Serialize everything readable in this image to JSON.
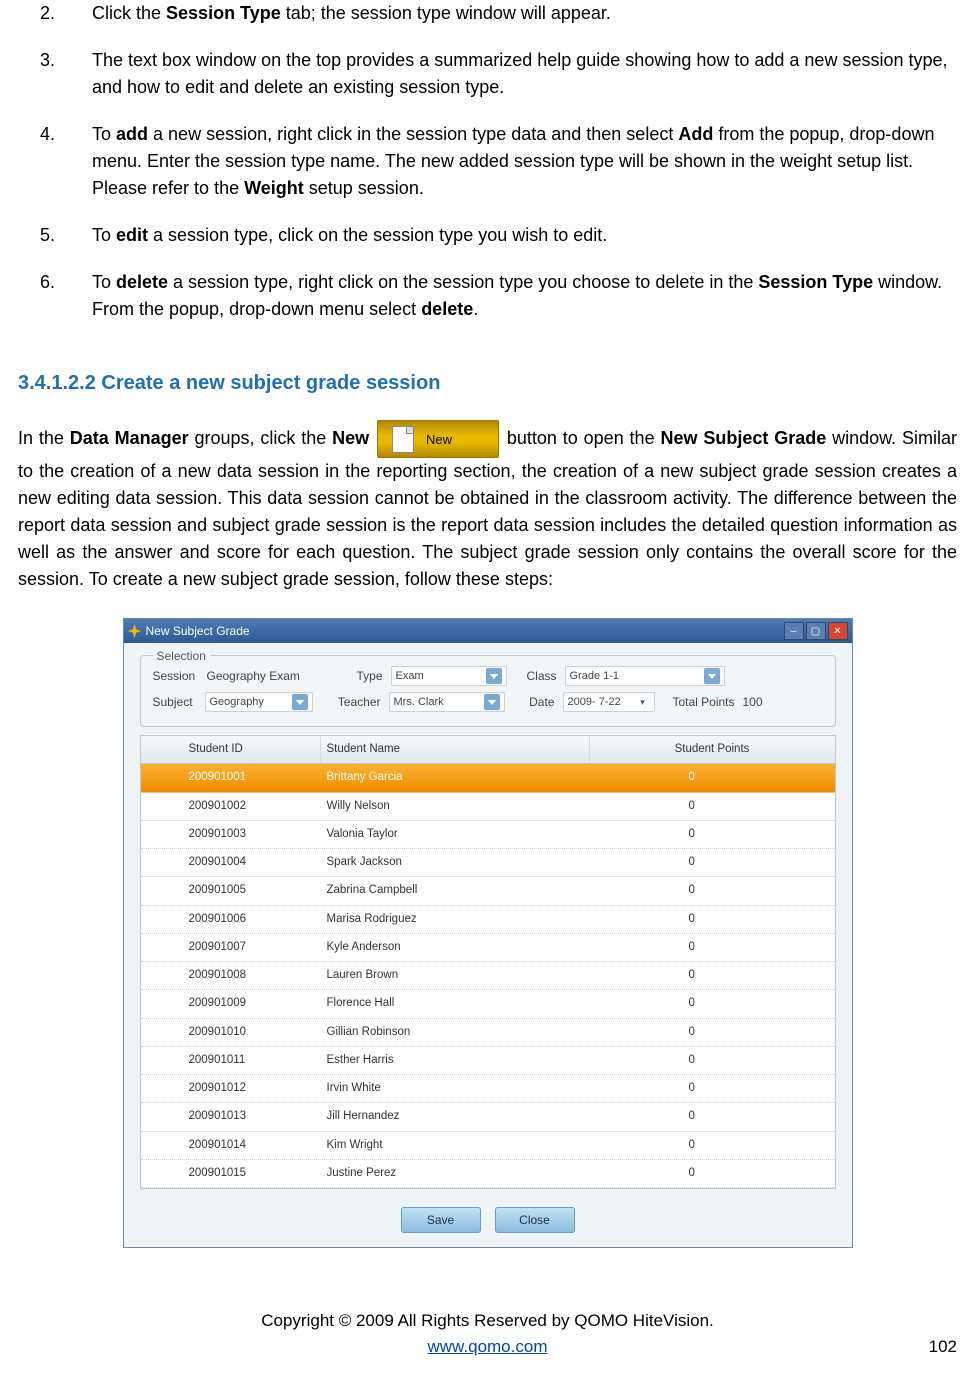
{
  "steps": [
    {
      "num": "2.",
      "html": "Click the <b>Session Type</b> tab; the session type window will appear."
    },
    {
      "num": "3.",
      "html": "The text box window on the top provides a summarized help guide showing how to add a new session type, and how to edit and delete an existing session type."
    },
    {
      "num": "4.",
      "html": "To <b>add</b> a new session, right click in the session type data and then select <b>Add</b> from the popup, drop-down menu. Enter the session type name. The new added session type will be shown in the weight setup list. Please refer to the <b>Weight</b> setup session."
    },
    {
      "num": "5.",
      "html": "To <b>edit</b> a session type, click on the session type you wish to edit."
    },
    {
      "num": "6.",
      "html": "To <b>delete</b> a session type, right click on the session type you choose to delete in the <b>Session Type</b> window. From the popup, drop-down menu select <b>delete</b>."
    }
  ],
  "heading": "3.4.1.2.2  Create a new subject grade session",
  "paragraph": {
    "pre": "In the <b>Data Manager</b> groups, click the <b>New</b> ",
    "post": " button to open the <b>New Subject Grade</b> window. Similar to the creation of a new data session in the reporting section, the creation of a new subject grade session creates a new editing data session. This data session cannot be obtained in the classroom activity. The difference between the report data session and subject grade session is the report data session includes the detailed question information as well as the answer and score for each question. The subject grade session only contains the overall score for the session. To create a new subject grade session, follow these steps:"
  },
  "new_button_label": "New",
  "window": {
    "title": "New Subject Grade",
    "selection_legend": "Selection",
    "labels": {
      "session": "Session",
      "type": "Type",
      "class": "Class",
      "subject": "Subject",
      "teacher": "Teacher",
      "date": "Date",
      "total_points": "Total Points"
    },
    "fields": {
      "session": "Geography Exam",
      "type": "Exam",
      "class": "Grade 1-1",
      "subject": "Geography",
      "teacher": "Mrs. Clark",
      "date": "2009- 7-22",
      "total_points": "100"
    },
    "columns": {
      "id": "Student ID",
      "name": "Student Name",
      "points": "Student Points"
    },
    "rows": [
      {
        "id": "200901001",
        "name": "Brittany Garcia",
        "points": "0",
        "selected": true
      },
      {
        "id": "200901002",
        "name": "Willy Nelson",
        "points": "0"
      },
      {
        "id": "200901003",
        "name": "Valonia Taylor",
        "points": "0"
      },
      {
        "id": "200901004",
        "name": "Spark Jackson",
        "points": "0"
      },
      {
        "id": "200901005",
        "name": "Zabrina Campbell",
        "points": "0"
      },
      {
        "id": "200901006",
        "name": "Marisa Rodriguez",
        "points": "0"
      },
      {
        "id": "200901007",
        "name": "Kyle Anderson",
        "points": "0"
      },
      {
        "id": "200901008",
        "name": "Lauren Brown",
        "points": "0"
      },
      {
        "id": "200901009",
        "name": "Florence Hall",
        "points": "0"
      },
      {
        "id": "200901010",
        "name": "Gillian Robinson",
        "points": "0"
      },
      {
        "id": "200901011",
        "name": "Esther Harris",
        "points": "0"
      },
      {
        "id": "200901012",
        "name": "Irvin White",
        "points": "0"
      },
      {
        "id": "200901013",
        "name": "Jill  Hernandez",
        "points": "0"
      },
      {
        "id": "200901014",
        "name": "Kim Wright",
        "points": "0"
      },
      {
        "id": "200901015",
        "name": "Justine Perez",
        "points": "0"
      }
    ],
    "buttons": {
      "save": "Save",
      "close": "Close"
    }
  },
  "footer": {
    "copyright": "Copyright © 2009 All Rights Reserved by QOMO HiteVision.",
    "link": "www.qomo.com",
    "page": "102"
  }
}
